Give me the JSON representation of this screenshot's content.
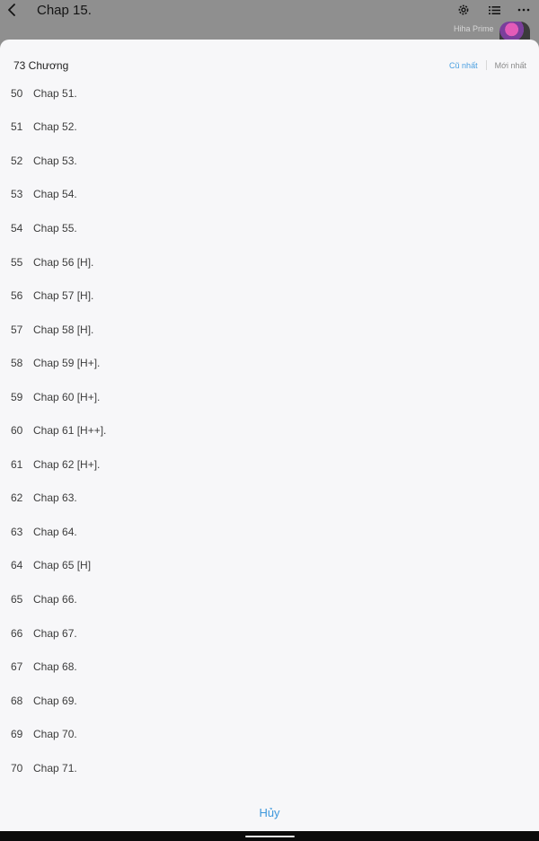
{
  "top_bar": {
    "title": "Chap 15.",
    "channel_name": "Hiha Prime",
    "icons": [
      "back-icon",
      "gear-icon",
      "list-icon",
      "more-icon"
    ]
  },
  "sheet": {
    "chapter_count": "73 Chương",
    "sort_oldest": "Cũ nhất",
    "sort_newest": "Mới nhất",
    "chapters": [
      {
        "index": "50",
        "title": "Chap 51."
      },
      {
        "index": "51",
        "title": "Chap 52."
      },
      {
        "index": "52",
        "title": "Chap 53."
      },
      {
        "index": "53",
        "title": "Chap 54."
      },
      {
        "index": "54",
        "title": "Chap 55."
      },
      {
        "index": "55",
        "title": "Chap 56 [H]."
      },
      {
        "index": "56",
        "title": "Chap 57 [H]."
      },
      {
        "index": "57",
        "title": "Chap 58 [H]."
      },
      {
        "index": "58",
        "title": "Chap 59 [H+]."
      },
      {
        "index": "59",
        "title": "Chap 60 [H+]."
      },
      {
        "index": "60",
        "title": "Chap 61 [H++]."
      },
      {
        "index": "61",
        "title": "Chap 62 [H+]."
      },
      {
        "index": "62",
        "title": "Chap 63."
      },
      {
        "index": "63",
        "title": "Chap 64."
      },
      {
        "index": "64",
        "title": "Chap 65 [H]"
      },
      {
        "index": "65",
        "title": "Chap 66."
      },
      {
        "index": "66",
        "title": "Chap 67."
      },
      {
        "index": "67",
        "title": "Chap 68."
      },
      {
        "index": "68",
        "title": "Chap 69."
      },
      {
        "index": "69",
        "title": "Chap 70."
      },
      {
        "index": "70",
        "title": "Chap 71."
      }
    ],
    "cancel_label": "Hủy"
  },
  "colors": {
    "accent": "#3d97dc",
    "sheet_background": "#f7f7f9",
    "scrim": "#8e8e8e"
  }
}
